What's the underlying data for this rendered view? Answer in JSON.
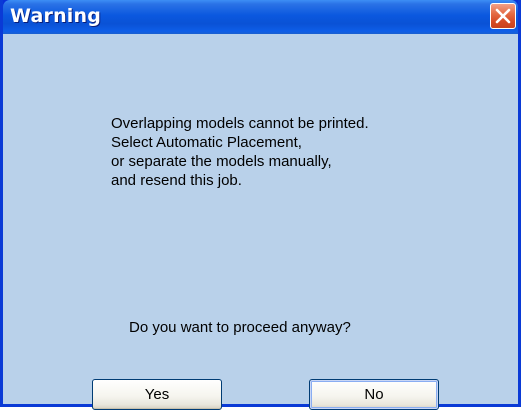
{
  "window": {
    "title": "Warning"
  },
  "titlebar": {
    "close_icon": "close-icon"
  },
  "message": {
    "lines": [
      "Overlapping models cannot be printed.",
      "Select Automatic Placement,",
      "or separate the models manually,",
      "and resend this job."
    ],
    "question": "Do you want to proceed anyway?"
  },
  "buttons": {
    "yes_label": "Yes",
    "no_label": "No"
  },
  "colors": {
    "titlebar_blue": "#0a52d6",
    "client_background": "#b9d1ea",
    "close_red": "#d54a24"
  }
}
